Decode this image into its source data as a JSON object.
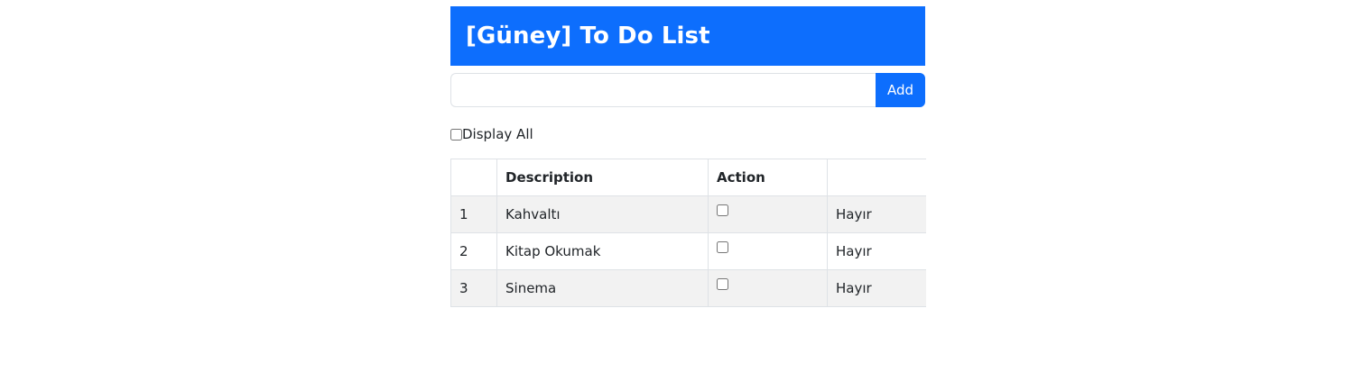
{
  "header": {
    "title": "[Güney] To Do List"
  },
  "new_item": {
    "value": "",
    "placeholder": "",
    "add_label": "Add"
  },
  "display_all": {
    "label": "Display All",
    "checked": false
  },
  "table": {
    "columns": [
      "",
      "Description",
      "Action",
      ""
    ],
    "rows": [
      {
        "index": "1",
        "description": "Kahvaltı",
        "done": false,
        "status": "Hayır"
      },
      {
        "index": "2",
        "description": "Kitap Okumak",
        "done": false,
        "status": "Hayır"
      },
      {
        "index": "3",
        "description": "Sinema",
        "done": false,
        "status": "Hayır"
      }
    ]
  },
  "colors": {
    "primary": "#0d6efd",
    "striped_row": "#f2f2f2",
    "border": "#dee2e6"
  }
}
